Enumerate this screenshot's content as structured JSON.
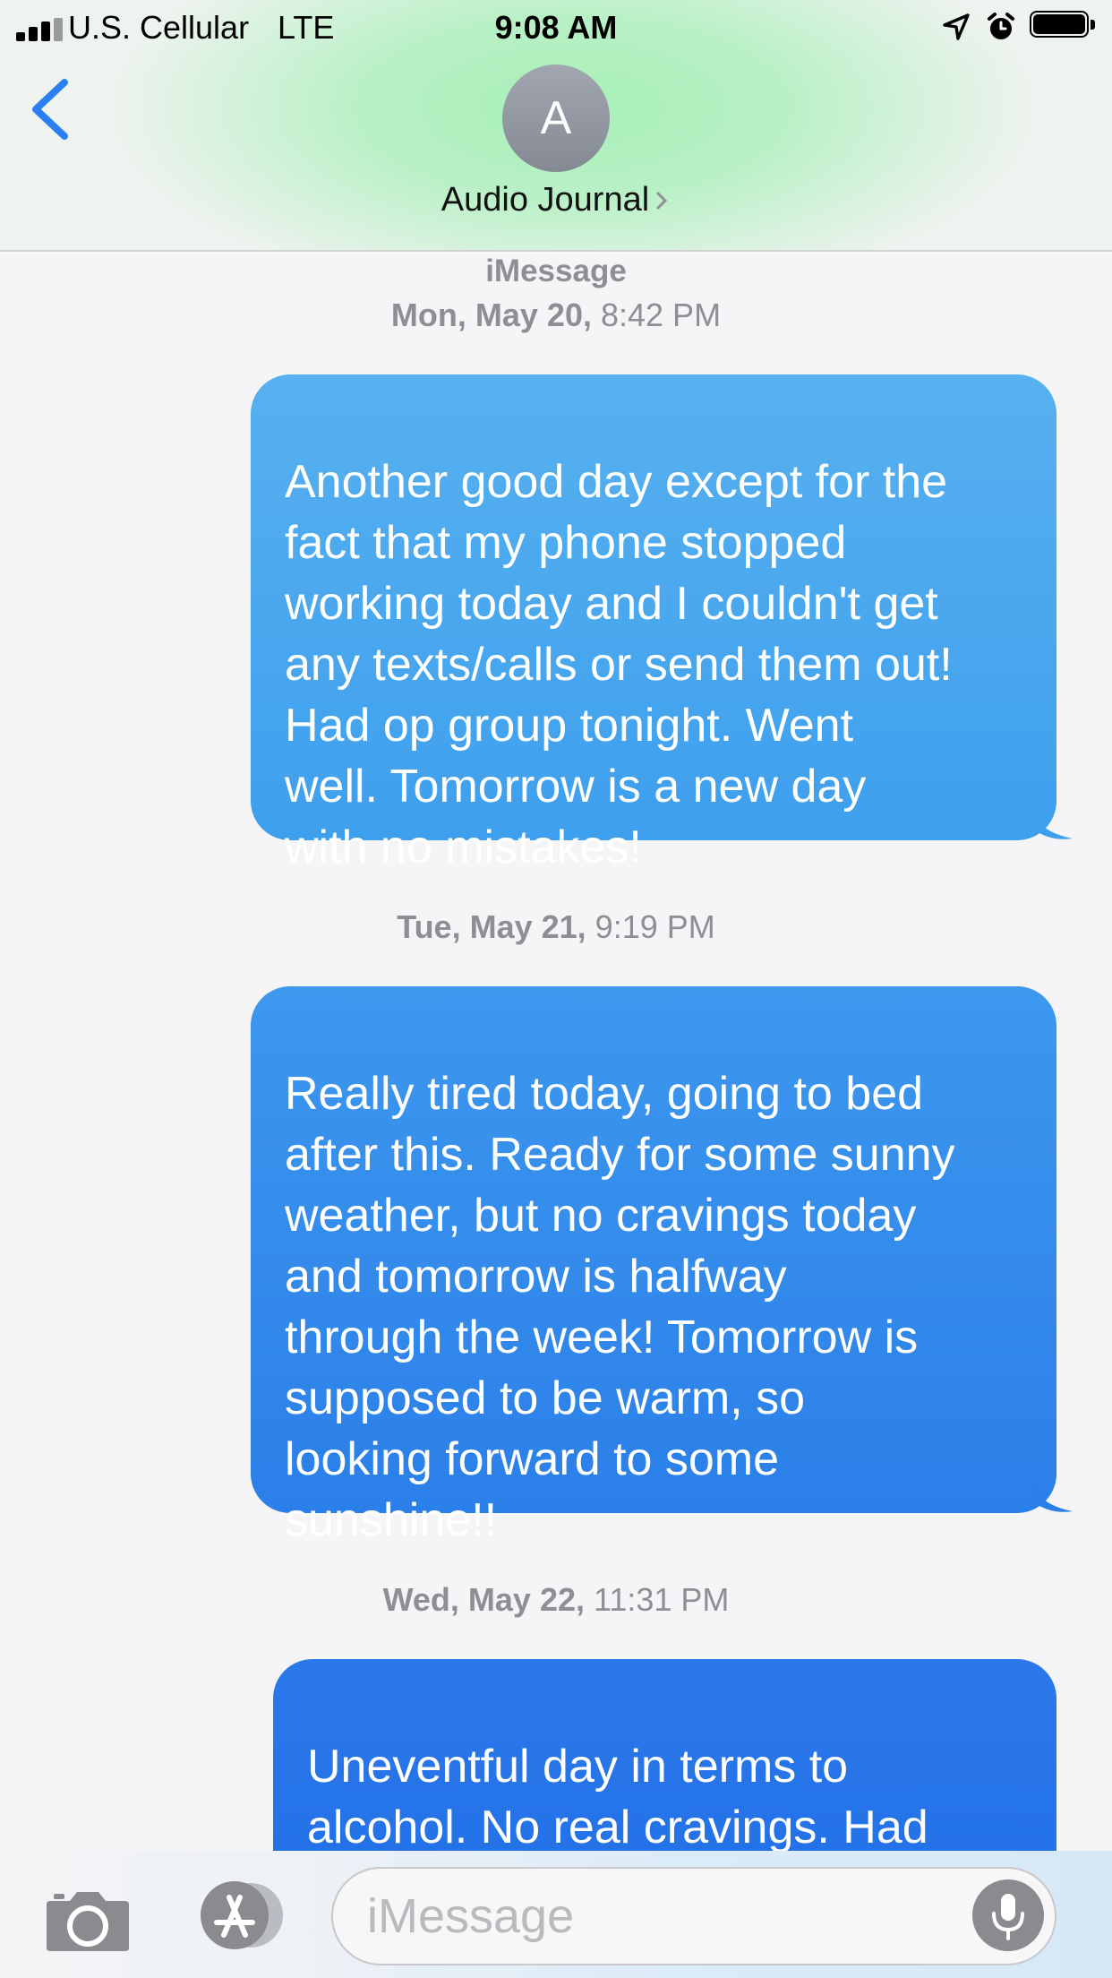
{
  "status_bar": {
    "carrier": "U.S. Cellular",
    "network": "LTE",
    "time": "9:08 AM",
    "signal_bars": 3,
    "battery_level": 1.0
  },
  "header": {
    "avatar_initial": "A",
    "contact_name": "Audio Journal"
  },
  "conversation": {
    "service": "iMessage",
    "messages": [
      {
        "day": "Mon, May 20,",
        "time": " 8:42 PM",
        "text": "Another good day except for the\nfact that my phone stopped\nworking today and I couldn't get\nany texts/calls or send them out!\nHad op group tonight. Went\nwell. Tomorrow is a new day\nwith no mistakes!"
      },
      {
        "day": "Tue, May 21,",
        "time": " 9:19 PM",
        "text": "Really tired today, going to bed\nafter this. Ready for some sunny\nweather, but no cravings today\nand tomorrow is halfway\nthrough the week! Tomorrow is\nsupposed to be warm, so\nlooking forward to some\nsunshine!!"
      },
      {
        "day": "Wed, May 22,",
        "time": " 11:31 PM",
        "text": "Uneventful day in terms to\nalcohol. No real cravings. Had\nan informational group session"
      }
    ]
  },
  "input_bar": {
    "placeholder": "iMessage",
    "icons": [
      "camera-icon",
      "app-store-icon",
      "microphone-icon"
    ]
  },
  "colors": {
    "bubble_blue": "#3e9fee",
    "link_blue": "#2a7ff2",
    "timestamp_gray": "#8e8e93"
  }
}
